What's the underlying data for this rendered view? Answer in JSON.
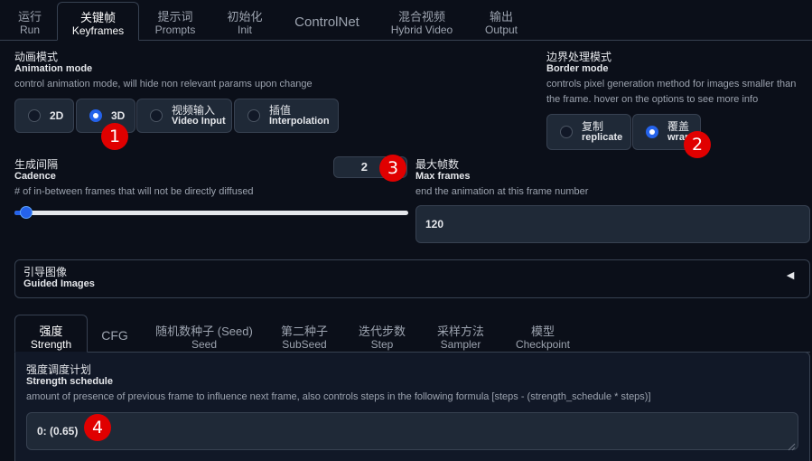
{
  "top_tabs": [
    {
      "zh": "运行",
      "en": "Run"
    },
    {
      "zh": "关键帧",
      "en": "Keyframes"
    },
    {
      "zh": "提示词",
      "en": "Prompts"
    },
    {
      "zh": "初始化",
      "en": "Init"
    },
    {
      "zh": "",
      "en": "ControlNet"
    },
    {
      "zh": "混合视频",
      "en": "Hybrid Video"
    },
    {
      "zh": "输出",
      "en": "Output"
    }
  ],
  "animation_mode": {
    "zh": "动画模式",
    "en": "Animation mode",
    "desc": "control animation mode, will hide non relevant params upon change",
    "options": [
      {
        "zh": "",
        "en": "2D"
      },
      {
        "zh": "",
        "en": "3D"
      },
      {
        "zh": "视频输入",
        "en": "Video Input"
      },
      {
        "zh": "插值",
        "en": "Interpolation"
      }
    ],
    "selected": "3D"
  },
  "border_mode": {
    "zh": "边界处理模式",
    "en": "Border mode",
    "desc_line1": "controls pixel generation method for images smaller than",
    "desc_line2": "the frame. hover on the options to see more info",
    "options": [
      {
        "zh": "复制",
        "en": "replicate"
      },
      {
        "zh": "覆盖",
        "en": "wrap"
      }
    ],
    "selected": "wrap"
  },
  "cadence": {
    "zh": "生成间隔",
    "en": "Cadence",
    "desc": "# of in-between frames that will not be directly diffused",
    "value": "2",
    "slider_fraction": 0.03
  },
  "max_frames": {
    "zh": "最大帧数",
    "en": "Max frames",
    "desc": "end the animation at this frame number",
    "value": "120"
  },
  "guided_images": {
    "zh": "引导图像",
    "en": "Guided Images",
    "arrow": "◄"
  },
  "schedule_tabs": [
    {
      "zh": "强度",
      "en": "Strength"
    },
    {
      "zh": "",
      "en": "CFG"
    },
    {
      "zh": "随机数种子 (Seed)",
      "en": "Seed"
    },
    {
      "zh": "第二种子",
      "en": "SubSeed"
    },
    {
      "zh": "迭代步数",
      "en": "Step"
    },
    {
      "zh": "采样方法",
      "en": "Sampler"
    },
    {
      "zh": "模型",
      "en": "Checkpoint"
    }
  ],
  "strength_schedule": {
    "zh": "强度调度计划",
    "en": "Strength schedule",
    "desc": "amount of presence of previous frame to influence next frame, also controls steps in the following formula [steps - (strength_schedule * steps)]",
    "value": "0: (0.65)"
  },
  "markers": [
    "1",
    "2",
    "3",
    "4"
  ],
  "colors": {
    "accent": "#2563eb",
    "marker": "#e00000",
    "background": "#0b0f19"
  }
}
